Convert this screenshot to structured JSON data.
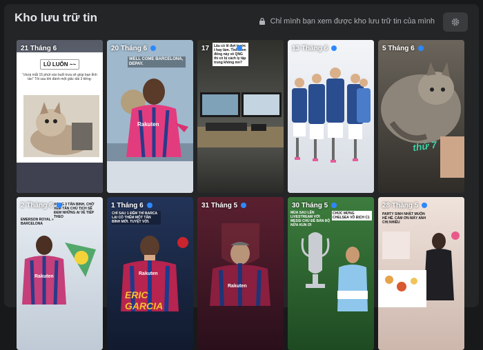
{
  "header": {
    "title": "Kho lưu trữ tin",
    "privacy_text": "Chỉ mình bạn xem được kho lưu trữ tin của mình"
  },
  "colors": {
    "accent": "#2d88ff",
    "background": "#18191a",
    "panel": "#242526"
  },
  "stories": [
    {
      "date": "21 Tháng 6",
      "caption_title": "LỦ LUÔN ~~",
      "caption_text": "\"chợp mắt 15 phút vào buổi trưa sẽ giúp bạn tỉnh táo\" Tôi sau khi đánh một giấc dài 3 tiếng:"
    },
    {
      "date": "20 Tháng 6",
      "caption_title": "WELL COME BARCELONA, DEPAY.",
      "jersey_text": "Rakuten"
    },
    {
      "date": "17",
      "caption_text": "Lâu có lẽ đợt trước t hay làm. Tình đem đống này về QNG thì có bị cách ly tập trung không mn?"
    },
    {
      "date": "13 Tháng 6"
    },
    {
      "date": "5 Tháng 6",
      "sticker": "thứ 7"
    },
    {
      "date": "2 Tháng 6",
      "caption_title": "EMERSON ROYAL » BARCELONA",
      "caption_text": "XONG 3 TÂN BINH, CHỜ XEM TÂN CHỦ TỊCH SẼ ĐEM NHỮNG AI VỀ TIẾP THEO",
      "jersey_text": "Rakuten"
    },
    {
      "date": "1 Tháng 6",
      "caption_text": "CHỈ SAU 1 ĐÊM THÌ BARCA LẠI CÓ THÊM MỘT TÂN BINH MỚI. TUYỆT VỜI.",
      "jersey_text": "Rakuten",
      "name_text": "ERIC GARCIA"
    },
    {
      "date": "31 Tháng 5",
      "jersey_text": "Rakuten"
    },
    {
      "date": "30 Tháng 5",
      "caption_text": "MÙA SAU LÊN LIVESTREAM VỚI MESSI CHỦ ĐỀ BÁN ĐỘ NỮA KUN ƠI",
      "caption_title": "CHÚC MỪNG CHELSEA VÔ ĐỊCH C1"
    },
    {
      "date": "28 Tháng 5",
      "caption_text": "PARTY SINH NHẬT MUỘN HẾ HẾ. CẢM ƠN MẤY ANH CHỊ NHIỀU"
    }
  ]
}
